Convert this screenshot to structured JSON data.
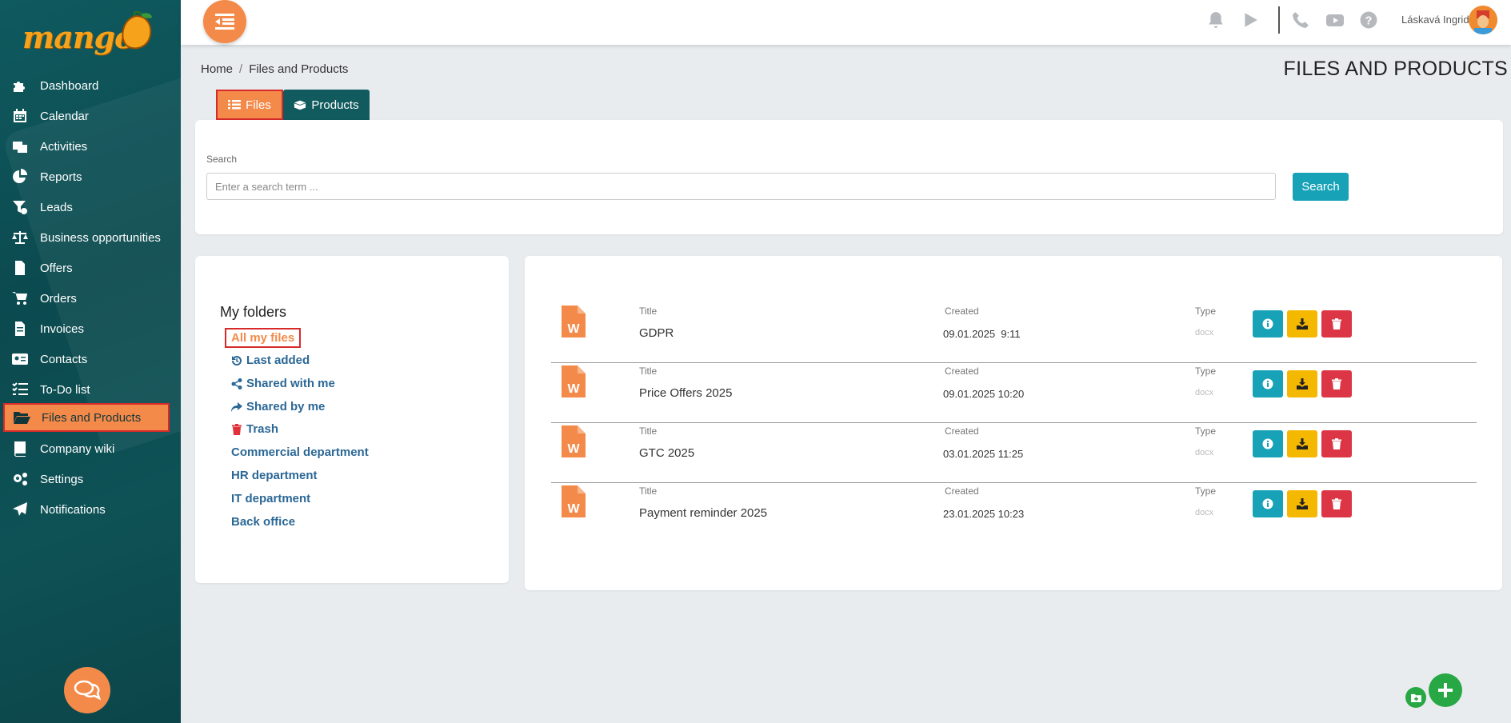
{
  "app": {
    "logo_text": "mango"
  },
  "sidebar": {
    "items": [
      {
        "label": "Dashboard",
        "icon": "puzzle-icon"
      },
      {
        "label": "Calendar",
        "icon": "calendar-icon"
      },
      {
        "label": "Activities",
        "icon": "activities-icon"
      },
      {
        "label": "Reports",
        "icon": "pie-chart-icon"
      },
      {
        "label": "Leads",
        "icon": "funnel-icon"
      },
      {
        "label": "Business opportunities",
        "icon": "scale-icon"
      },
      {
        "label": "Offers",
        "icon": "document-icon"
      },
      {
        "label": "Orders",
        "icon": "cart-icon"
      },
      {
        "label": "Invoices",
        "icon": "invoice-icon"
      },
      {
        "label": "Contacts",
        "icon": "contact-card-icon"
      },
      {
        "label": "To-Do list",
        "icon": "checklist-icon"
      },
      {
        "label": "Files and Products",
        "icon": "folder-open-icon",
        "active": true
      },
      {
        "label": "Company wiki",
        "icon": "book-icon"
      },
      {
        "label": "Settings",
        "icon": "gears-icon"
      },
      {
        "label": "Notifications",
        "icon": "paper-plane-icon"
      }
    ]
  },
  "topbar": {
    "icons": [
      "bell-icon",
      "play-icon",
      "phone-icon",
      "youtube-icon",
      "help-icon"
    ],
    "user_name": "Láskavá Ingrid"
  },
  "breadcrumb": {
    "home": "Home",
    "separator": "/",
    "current": "Files and Products"
  },
  "page_title": "FILES AND PRODUCTS",
  "tabs": {
    "files": "Files",
    "products": "Products"
  },
  "search": {
    "label": "Search",
    "placeholder": "Enter a search term ...",
    "button": "Search"
  },
  "folders": {
    "title": "My folders",
    "items": [
      {
        "label": "All my files",
        "active": true
      },
      {
        "label": "Last added",
        "icon": "history-icon"
      },
      {
        "label": "Shared with me",
        "icon": "share-icon"
      },
      {
        "label": "Shared by me",
        "icon": "share-arrow-icon"
      },
      {
        "label": "Trash",
        "icon": "trash-icon"
      },
      {
        "label": "Commercial department"
      },
      {
        "label": "HR department"
      },
      {
        "label": "IT department"
      },
      {
        "label": "Back office"
      }
    ]
  },
  "files": {
    "columns": {
      "title": "Title",
      "created": "Created",
      "type": "Type"
    },
    "rows": [
      {
        "title": "GDPR",
        "created": "09.01.2025  9:11",
        "type": "docx"
      },
      {
        "title": "Price Offers 2025",
        "created": "09.01.2025 10:20",
        "type": "docx"
      },
      {
        "title": "GTC 2025",
        "created": "03.01.2025 11:25",
        "type": "docx"
      },
      {
        "title": "Payment reminder 2025",
        "created": "23.01.2025 10:23",
        "type": "docx"
      }
    ]
  },
  "colors": {
    "accent": "#f48a4a",
    "sidebar": "#0f5a5f",
    "info": "#17a2b8",
    "warning": "#f5b800",
    "danger": "#dc3545",
    "success": "#28a745"
  }
}
